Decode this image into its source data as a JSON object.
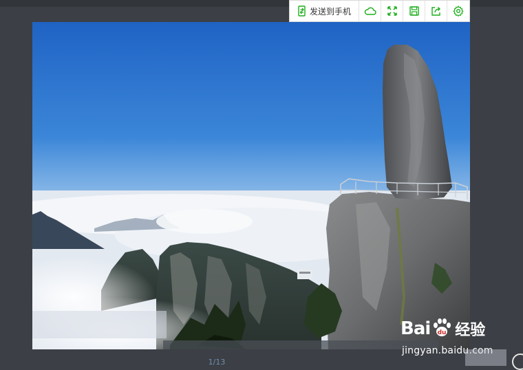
{
  "toolbar": {
    "send_to_phone_label": "发送到手机",
    "buttons": [
      {
        "name": "send-to-phone",
        "icon": "phone-send-icon"
      },
      {
        "name": "cloud-save",
        "icon": "cloud-icon"
      },
      {
        "name": "fullscreen",
        "icon": "expand-icon"
      },
      {
        "name": "save",
        "icon": "floppy-disk-icon"
      },
      {
        "name": "share",
        "icon": "share-export-icon"
      },
      {
        "name": "settings",
        "icon": "gear-icon"
      }
    ],
    "accent_color": "#1aad19"
  },
  "pager": {
    "text": "1/13"
  },
  "watermark": {
    "brand_left": "Bai",
    "brand_right": "经验",
    "url": "jingyan.baidu.com"
  }
}
